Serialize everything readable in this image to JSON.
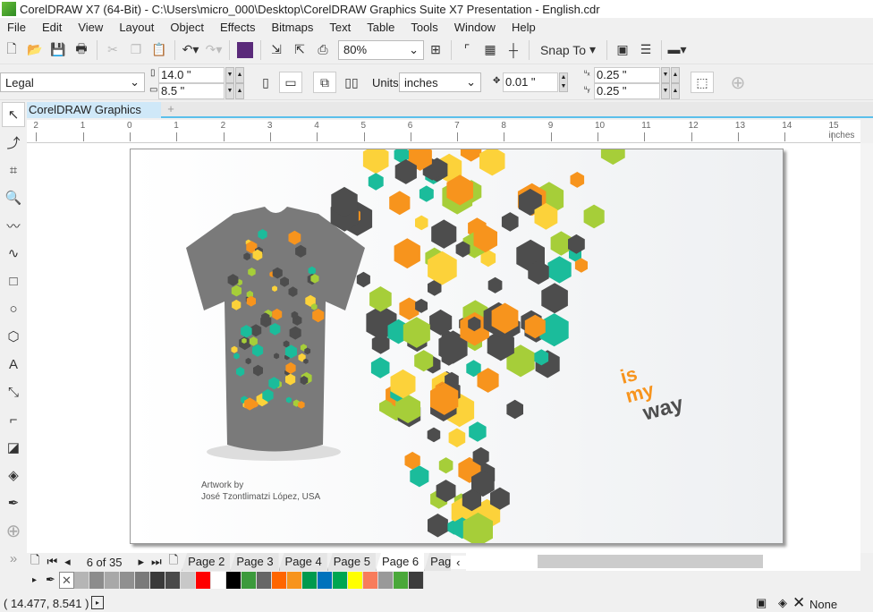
{
  "title": "CorelDRAW X7 (64-Bit) - C:\\Users\\micro_000\\Desktop\\CorelDRAW Graphics Suite X7 Presentation - English.cdr",
  "menu": [
    "File",
    "Edit",
    "View",
    "Layout",
    "Object",
    "Effects",
    "Bitmaps",
    "Text",
    "Table",
    "Tools",
    "Window",
    "Help"
  ],
  "toolbar": {
    "zoom": "80%",
    "snap_to": "Snap To"
  },
  "propbar": {
    "page_size": "Legal",
    "width": "14.0 \"",
    "height": "8.5 \"",
    "units_label": "Units:",
    "units": "inches",
    "nudge": "0.01 \"",
    "dup_x": "0.25 \"",
    "dup_y": "0.25 \""
  },
  "doc_tab": "CorelDRAW Graphics S...",
  "ruler": {
    "labels": [
      "2",
      "1",
      "0",
      "1",
      "2",
      "3",
      "4",
      "5",
      "6",
      "7",
      "8",
      "9",
      "10",
      "11",
      "12",
      "13",
      "14",
      "15 inches"
    ]
  },
  "artwork": {
    "credit_line1": "Artwork by",
    "credit_line2": "José Tzontlimatzi López, USA",
    "slogan": [
      "is",
      "my",
      "way"
    ],
    "colors": {
      "orange": "#f7941d",
      "lime": "#a6ce39",
      "teal": "#1bbc9b",
      "dark": "#4d4d4d",
      "yellow": "#fcd23a",
      "shirt": "#7a7a7a"
    }
  },
  "pages": {
    "counter": "6 of 35",
    "tabs": [
      "Page 2",
      "Page 3",
      "Page 4",
      "Page 5",
      "Page 6",
      "Pag"
    ],
    "active": "Page 6"
  },
  "palette": [
    "#b5b5b5",
    "#8c8c8c",
    "#a8a8a8",
    "#909090",
    "#7a7a7a",
    "#3a3a3a",
    "#4a4a4a",
    "#c8c8c8",
    "#ff0000",
    "#ffffff",
    "#000000",
    "#3c9a3c",
    "#666666",
    "#ff6600",
    "#f7941d",
    "#009a4e",
    "#0072bc",
    "#00a651",
    "#ffff00",
    "#f87c5b",
    "#999999",
    "#4aa83a",
    "#3c3c3c"
  ],
  "status": {
    "coords": "( 14.477, 8.541 )",
    "fill": "None"
  }
}
